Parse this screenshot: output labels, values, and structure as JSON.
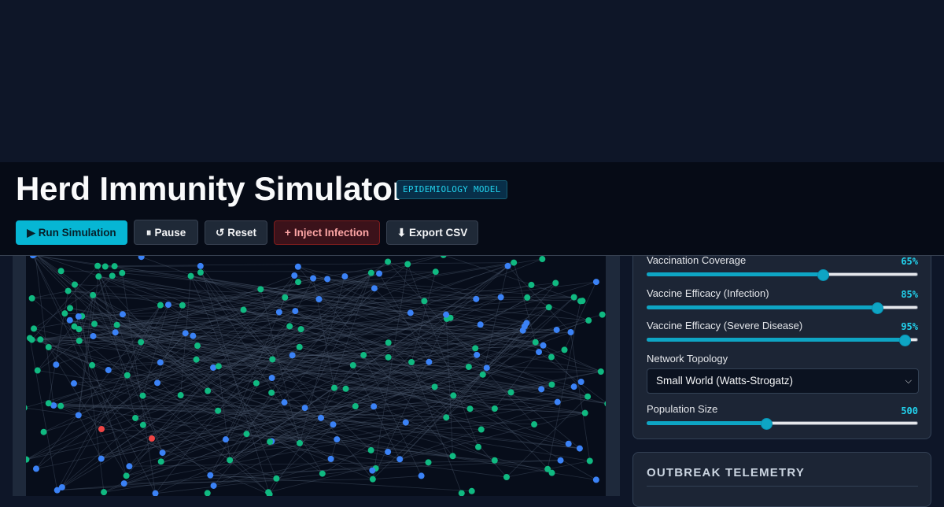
{
  "header": {
    "title": "Herd Immunity Simulator",
    "badge": "EPIDEMIOLOGY MODEL"
  },
  "toolbar": {
    "run": {
      "icon": "play-icon",
      "glyph": "▶",
      "label": "Run Simulation"
    },
    "pause": {
      "icon": "pause-icon",
      "glyph": "⏸",
      "label": "Pause"
    },
    "reset": {
      "icon": "reset-icon",
      "glyph": "↺",
      "label": "Reset"
    },
    "inject": {
      "icon": "plus-icon",
      "glyph": "+",
      "label": "Inject Infection"
    },
    "export": {
      "icon": "download-icon",
      "glyph": "⬇",
      "label": "Export CSV"
    }
  },
  "controls": {
    "vaccination": {
      "label": "Vaccination Coverage",
      "value_text": "65%",
      "level": 0.65
    },
    "efficacy_infection": {
      "label": "Vaccine Efficacy (Infection)",
      "value_text": "85%",
      "level": 0.85
    },
    "efficacy_severe": {
      "label": "Vaccine Efficacy (Severe Disease)",
      "value_text": "95%",
      "level": 0.95
    },
    "topology": {
      "label": "Network Topology",
      "selected": "Small World (Watts-Strogatz)"
    },
    "population": {
      "label": "Population Size",
      "value_text": "500",
      "level": 0.44
    }
  },
  "telemetry": {
    "title": "OUTBREAK TELEMETRY"
  },
  "colors": {
    "accent": "#06b6d4",
    "node_vaccinated": "#10b981",
    "node_susceptible": "#3b82f6",
    "node_infected": "#ef4444",
    "edge": "#475569"
  }
}
